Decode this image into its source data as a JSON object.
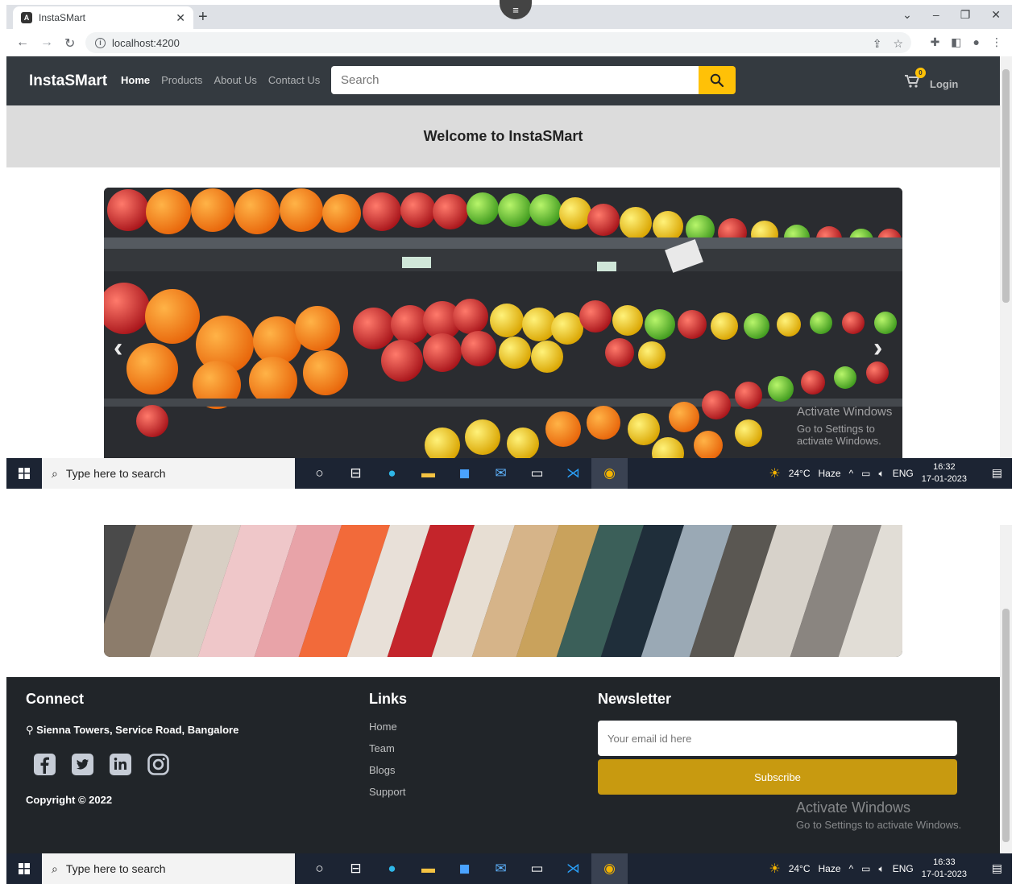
{
  "browser": {
    "tab_title": "InstaSMart",
    "url": "localhost:4200"
  },
  "navbar": {
    "brand": "InstaSMart",
    "links": [
      "Home",
      "Products",
      "About Us",
      "Contact Us"
    ],
    "search_placeholder": "Search",
    "cart_count": "0",
    "login": "Login"
  },
  "welcome": "Welcome to InstaSMart",
  "carousel": {
    "prev_icon": "chevron-left-icon",
    "next_icon": "chevron-right-icon",
    "watermark_line1": "Activate Windows",
    "watermark_line2": "Go to Settings to activate Windows."
  },
  "footer": {
    "connect_title": "Connect",
    "address": "Sienna Towers, Service Road, Bangalore",
    "copyright": "Copyright © 2022",
    "links_title": "Links",
    "links": [
      "Home",
      "Team",
      "Blogs",
      "Support"
    ],
    "newsletter_title": "Newsletter",
    "email_placeholder": "Your email id here",
    "subscribe": "Subscribe",
    "activate_line1": "Activate Windows",
    "activate_line2": "Go to Settings to activate Windows."
  },
  "taskbar_top": {
    "search_placeholder": "Type here to search",
    "temp": "24°C",
    "weather": "Haze",
    "lang": "ENG",
    "time": "16:32",
    "date": "17-01-2023",
    "notifications": "1"
  },
  "taskbar_bottom": {
    "search_placeholder": "Type here to search",
    "temp": "24°C",
    "weather": "Haze",
    "lang": "ENG",
    "time": "16:33",
    "date": "17-01-2023",
    "notifications": "1"
  },
  "colors": {
    "navbar": "#343a40",
    "accent": "#ffc107",
    "footer": "#212529",
    "subscribe": "#c89a10"
  }
}
